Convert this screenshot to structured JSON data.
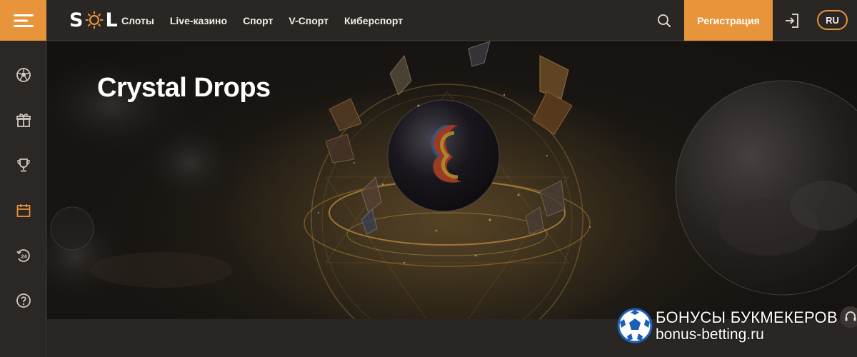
{
  "brand": {
    "logo_left": "S",
    "logo_right": "L",
    "accent": "#e8943a"
  },
  "nav": {
    "items": [
      {
        "label": "Слоты"
      },
      {
        "label": "Live-казино"
      },
      {
        "label": "Спорт"
      },
      {
        "label": "V-Спорт"
      },
      {
        "label": "Киберспорт"
      }
    ]
  },
  "header": {
    "register_label": "Регистрация",
    "lang_label": "RU",
    "search_icon": "search-icon",
    "login_icon": "login-icon"
  },
  "sidebar": {
    "items": [
      {
        "icon": "football-icon",
        "active": false
      },
      {
        "icon": "gift-icon",
        "active": false
      },
      {
        "icon": "trophy-icon",
        "active": false
      },
      {
        "icon": "calendar-icon",
        "active": true
      },
      {
        "icon": "support-24-icon",
        "active": false
      },
      {
        "icon": "help-icon",
        "active": false
      }
    ]
  },
  "banner": {
    "title": "Crystal Drops"
  },
  "watermark": {
    "line1": "БОНУСЫ БУКМЕКЕРОВ",
    "line2": "bonus-betting.ru"
  }
}
